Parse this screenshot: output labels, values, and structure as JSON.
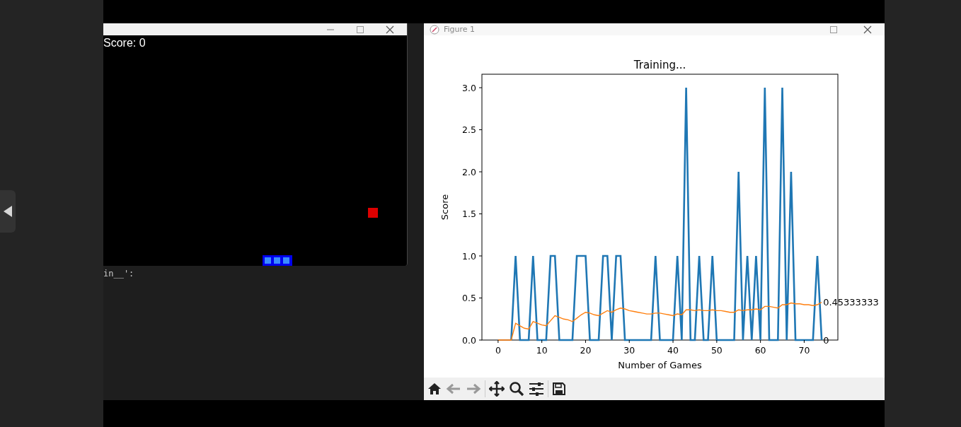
{
  "game_window": {
    "score_label": "Score: 0"
  },
  "editor": {
    "code_fragment": "in__':"
  },
  "figure": {
    "title": "Figure 1",
    "chart_data": {
      "type": "line",
      "title": "Training...",
      "xlabel": "Number of Games",
      "ylabel": "Score",
      "xlim": [
        -3.7,
        77.7
      ],
      "ylim": [
        0,
        3.16
      ],
      "xticks": [
        0,
        10,
        20,
        30,
        40,
        50,
        60,
        70
      ],
      "yticks": [
        {
          "value": 0,
          "label": "0.0"
        },
        {
          "value": 0.5,
          "label": "0.5"
        },
        {
          "value": 1,
          "label": "1.0"
        },
        {
          "value": 1.5,
          "label": "1.5"
        },
        {
          "value": 2,
          "label": "2.0"
        },
        {
          "value": 2.5,
          "label": "2.5"
        },
        {
          "value": 3,
          "label": "3.0"
        }
      ],
      "x": [
        0,
        1,
        2,
        3,
        4,
        5,
        6,
        7,
        8,
        9,
        10,
        11,
        12,
        13,
        14,
        15,
        16,
        17,
        18,
        19,
        20,
        21,
        22,
        23,
        24,
        25,
        26,
        27,
        28,
        29,
        30,
        31,
        32,
        33,
        34,
        35,
        36,
        37,
        38,
        39,
        40,
        41,
        42,
        43,
        44,
        45,
        46,
        47,
        48,
        49,
        50,
        51,
        52,
        53,
        54,
        55,
        56,
        57,
        58,
        59,
        60,
        61,
        62,
        63,
        64,
        65,
        66,
        67,
        68,
        69,
        70,
        71,
        72,
        73,
        74
      ],
      "series": [
        {
          "color": "#1f77b4",
          "values": [
            null,
            null,
            null,
            0,
            1,
            0,
            0,
            0,
            1,
            0,
            0,
            0,
            1,
            1,
            0,
            0,
            0,
            0,
            1,
            1,
            1,
            0,
            0,
            0,
            1,
            1,
            0,
            1,
            1,
            0,
            0,
            0,
            0,
            0,
            0,
            0,
            1,
            0,
            0,
            0,
            0,
            1,
            0,
            3,
            0,
            0,
            1,
            0,
            0,
            1,
            0,
            0,
            0,
            0,
            0,
            2,
            0,
            1,
            0,
            1,
            0,
            3,
            0,
            0,
            0,
            3,
            0,
            2,
            0,
            0,
            0,
            0,
            0,
            1,
            0
          ]
        },
        {
          "color": "#ff7f0e",
          "values": [
            0,
            0,
            0,
            0,
            0.2,
            0.17,
            0.14,
            0.13,
            0.22,
            0.2,
            0.18,
            0.17,
            0.23,
            0.29,
            0.27,
            0.25,
            0.24,
            0.22,
            0.26,
            0.3,
            0.33,
            0.32,
            0.3,
            0.29,
            0.32,
            0.35,
            0.33,
            0.36,
            0.38,
            0.37,
            0.35,
            0.34,
            0.33,
            0.32,
            0.31,
            0.31,
            0.32,
            0.32,
            0.31,
            0.3,
            0.29,
            0.31,
            0.3,
            0.36,
            0.36,
            0.35,
            0.36,
            0.35,
            0.35,
            0.36,
            0.35,
            0.35,
            0.34,
            0.33,
            0.33,
            0.36,
            0.35,
            0.36,
            0.36,
            0.37,
            0.36,
            0.4,
            0.4,
            0.39,
            0.38,
            0.42,
            0.42,
            0.44,
            0.43,
            0.43,
            0.42,
            0.42,
            0.41,
            0.42,
            0.45
          ]
        }
      ],
      "annotations": [
        {
          "x": 74,
          "y": 0.4533,
          "text": "0.45333333"
        },
        {
          "x": 74,
          "y": 0,
          "text": "0"
        }
      ]
    }
  }
}
